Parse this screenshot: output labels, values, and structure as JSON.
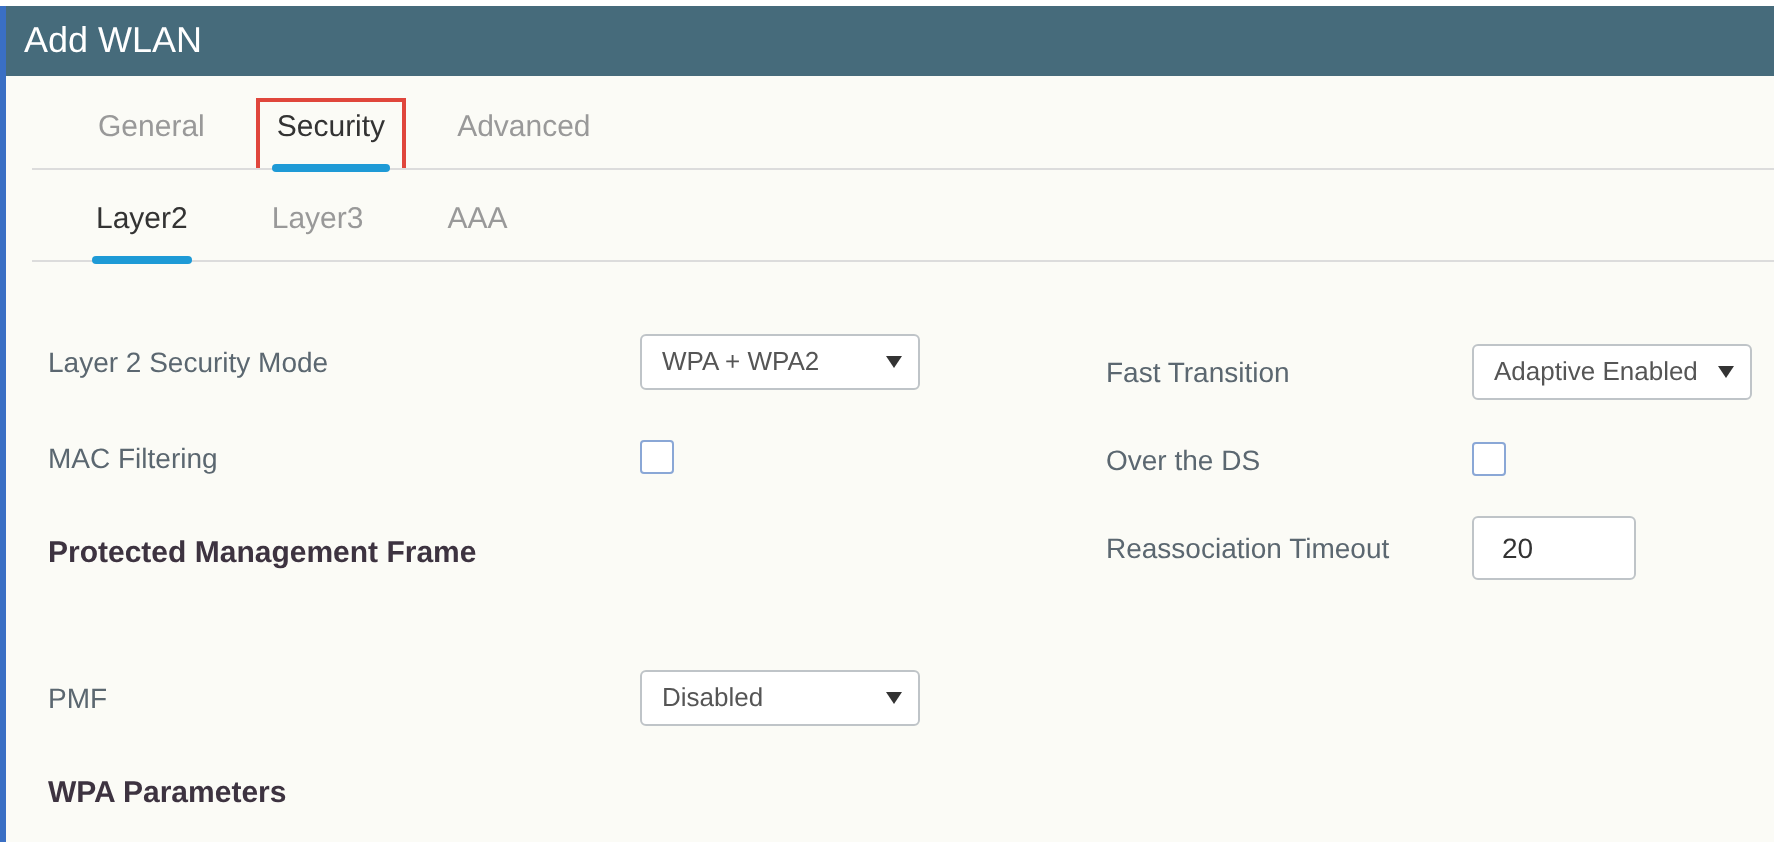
{
  "window": {
    "title": "Add WLAN"
  },
  "tabs": [
    {
      "label": "General",
      "selected": false,
      "highlighted": false
    },
    {
      "label": "Security",
      "selected": true,
      "highlighted": true
    },
    {
      "label": "Advanced",
      "selected": false,
      "highlighted": false
    }
  ],
  "subtabs": [
    {
      "label": "Layer2",
      "selected": true
    },
    {
      "label": "Layer3",
      "selected": false
    },
    {
      "label": "AAA",
      "selected": false
    }
  ],
  "left_fields": [
    {
      "kind": "select",
      "label": "Layer 2 Security Mode",
      "value": "WPA + WPA2"
    },
    {
      "kind": "checkbox",
      "label": "MAC Filtering",
      "checked": false
    },
    {
      "kind": "heading",
      "label": "Protected Management Frame"
    },
    {
      "kind": "select",
      "label": "PMF",
      "value": "Disabled"
    },
    {
      "kind": "heading",
      "label": "WPA Parameters"
    }
  ],
  "right_fields": [
    {
      "kind": "select",
      "label": "Fast Transition",
      "value": "Adaptive Enabled"
    },
    {
      "kind": "checkbox",
      "label": "Over the DS",
      "checked": false
    },
    {
      "kind": "input",
      "label": "Reassociation Timeout",
      "value": "20"
    }
  ]
}
